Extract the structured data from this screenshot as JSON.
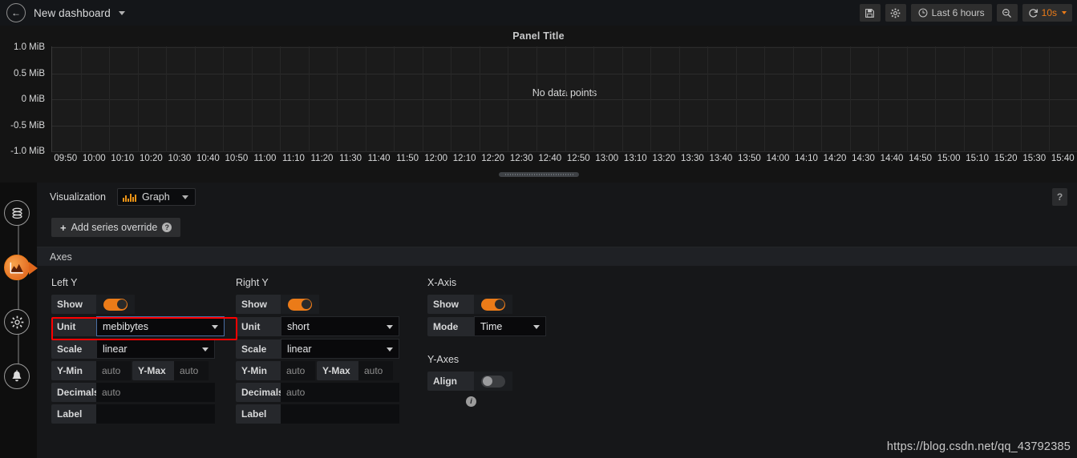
{
  "navbar": {
    "back_icon": "arrow-left-circle-icon",
    "dashboard_title": "New dashboard",
    "save_icon": "save-disk-icon",
    "settings_icon": "gear-icon",
    "time_range_icon": "clock-icon",
    "time_range": "Last 6 hours",
    "zoom_out_icon": "search-minus-icon",
    "refresh_icon": "refresh-icon",
    "refresh_interval": "10s",
    "accent_color": "#eb7b18"
  },
  "panel": {
    "title": "Panel Title",
    "no_data_text": "No data points",
    "drag_handle": "panel-resize-handle"
  },
  "chart_data": {
    "type": "line",
    "title": "Panel Title",
    "xlabel": "",
    "ylabel": "",
    "series": [],
    "empty_message": "No data points",
    "grid": true,
    "legend_position": "none",
    "ylim": [
      -1.0,
      1.0
    ],
    "y_unit": "MiB",
    "y_ticks": [
      "1.0 MiB",
      "0.5 MiB",
      "0 MiB",
      "-0.5 MiB",
      "-1.0 MiB"
    ],
    "y_values": [
      1.0,
      0.5,
      0,
      -0.5,
      -1.0
    ],
    "x_ticks": [
      "09:50",
      "10:00",
      "10:10",
      "10:20",
      "10:30",
      "10:40",
      "10:50",
      "11:00",
      "11:10",
      "11:20",
      "11:30",
      "11:40",
      "11:50",
      "12:00",
      "12:10",
      "12:20",
      "12:30",
      "12:40",
      "12:50",
      "13:00",
      "13:10",
      "13:20",
      "13:30",
      "13:40",
      "13:50",
      "14:00",
      "14:10",
      "14:20",
      "14:30",
      "14:40",
      "14:50",
      "15:00",
      "15:10",
      "15:20",
      "15:30",
      "15:40"
    ]
  },
  "rail": {
    "items": [
      {
        "name": "queries",
        "icon": "database-icon",
        "active": false
      },
      {
        "name": "visualization",
        "icon": "graph-area-icon",
        "active": true
      },
      {
        "name": "general",
        "icon": "gear-wrench-icon",
        "active": false
      },
      {
        "name": "alert",
        "icon": "bell-icon",
        "active": false
      }
    ]
  },
  "editor": {
    "visualization_label": "Visualization",
    "visualization_value": "Graph",
    "visualization_icon": "bar-chart-icon",
    "help_label": "?",
    "series_override_label": "Add series override",
    "series_override_help": "?",
    "section_title": "Axes"
  },
  "left_y": {
    "title": "Left Y",
    "show_label": "Show",
    "show_on": true,
    "unit_label": "Unit",
    "unit_value": "mebibytes",
    "scale_label": "Scale",
    "scale_value": "linear",
    "ymin_label": "Y-Min",
    "ymin_placeholder": "auto",
    "ymax_label": "Y-Max",
    "ymax_placeholder": "auto",
    "decimals_label": "Decimals",
    "decimals_placeholder": "auto",
    "axis_label_label": "Label",
    "axis_label_value": ""
  },
  "right_y": {
    "title": "Right Y",
    "show_label": "Show",
    "show_on": true,
    "unit_label": "Unit",
    "unit_value": "short",
    "scale_label": "Scale",
    "scale_value": "linear",
    "ymin_label": "Y-Min",
    "ymin_placeholder": "auto",
    "ymax_label": "Y-Max",
    "ymax_placeholder": "auto",
    "decimals_label": "Decimals",
    "decimals_placeholder": "auto",
    "axis_label_label": "Label",
    "axis_label_value": ""
  },
  "x_axis": {
    "title": "X-Axis",
    "show_label": "Show",
    "show_on": true,
    "mode_label": "Mode",
    "mode_value": "Time"
  },
  "y_axes": {
    "title": "Y-Axes",
    "align_label": "Align",
    "align_on": false,
    "info_icon": "info-icon"
  },
  "highlight": {
    "color": "#fe0000",
    "target": "left-y-unit-row"
  },
  "watermark": "https://blog.csdn.net/qq_43792385"
}
